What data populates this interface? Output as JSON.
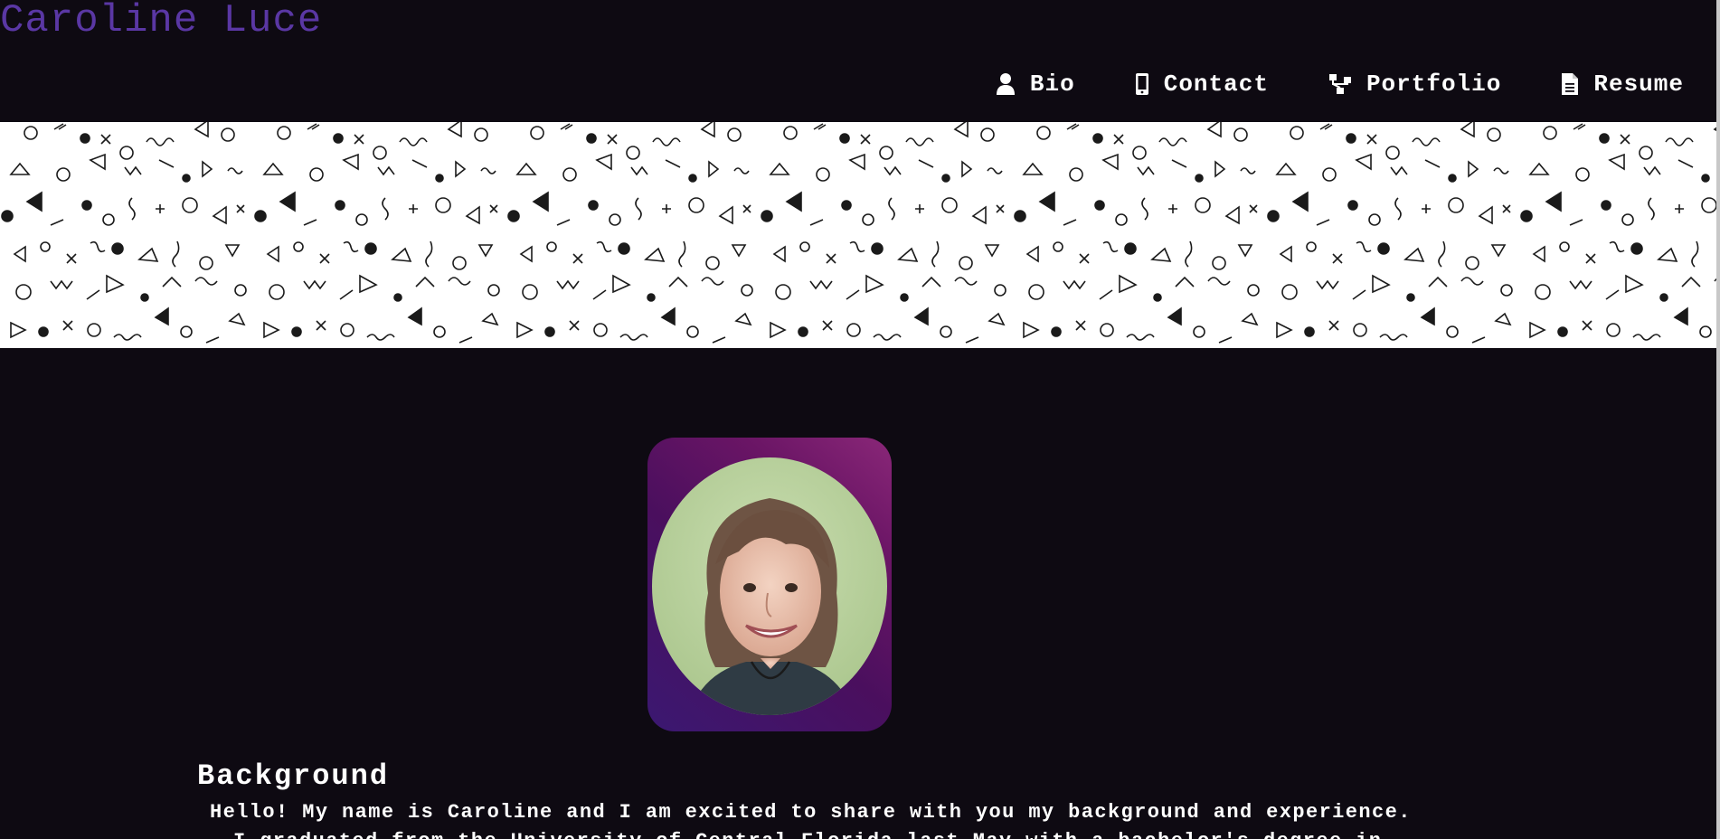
{
  "header": {
    "site_title": "Caroline Luce"
  },
  "nav": {
    "items": [
      {
        "label": "Bio",
        "icon": "user-icon"
      },
      {
        "label": "Contact",
        "icon": "mobile-phone-icon"
      },
      {
        "label": "Portfolio",
        "icon": "sitemap-icon"
      },
      {
        "label": "Resume",
        "icon": "document-icon"
      }
    ]
  },
  "banner": {
    "pattern": "memphis-geometric-shapes",
    "colors": {
      "background": "#ffffff",
      "shapes": "#1a1a1a"
    }
  },
  "profile": {
    "photo": "portrait-photo",
    "frame_gradient": [
      "#3b1871",
      "#8a2778"
    ]
  },
  "background": {
    "heading": "Background",
    "line_1": "Hello! My name is Caroline and I am excited to share with you my background and experience.",
    "line_2": "I graduated from the University of Central Florida last May with a bachelor's degree in"
  },
  "colors": {
    "page_background": "#0e0a12",
    "title_accent": "#5a37a4",
    "text": "#ffffff"
  }
}
